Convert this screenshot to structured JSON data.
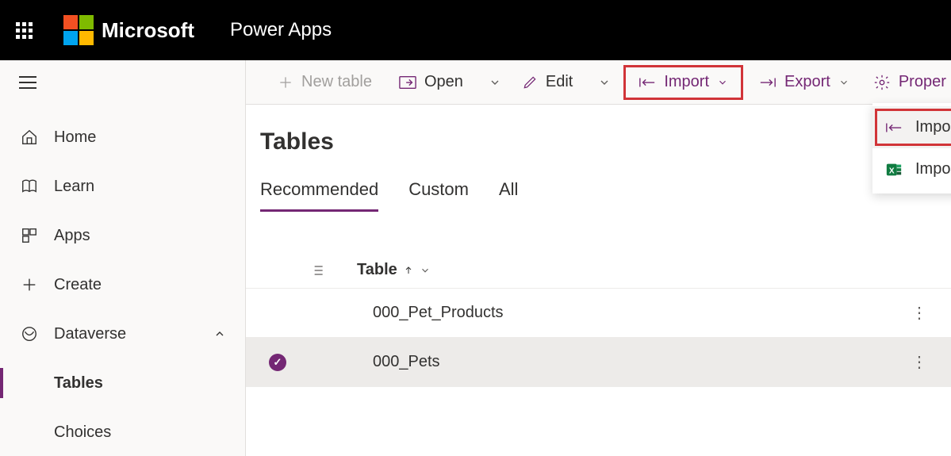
{
  "header": {
    "company": "Microsoft",
    "app": "Power Apps"
  },
  "sidebar": {
    "items": [
      {
        "key": "home",
        "label": "Home"
      },
      {
        "key": "learn",
        "label": "Learn"
      },
      {
        "key": "apps",
        "label": "Apps"
      },
      {
        "key": "create",
        "label": "Create"
      },
      {
        "key": "dataverse",
        "label": "Dataverse",
        "expanded": true,
        "children": [
          {
            "key": "tables",
            "label": "Tables",
            "selected": true
          },
          {
            "key": "choices",
            "label": "Choices"
          }
        ]
      }
    ]
  },
  "toolbar": {
    "new_table": "New table",
    "open": "Open",
    "edit": "Edit",
    "import": "Import",
    "export": "Export",
    "properties": "Proper"
  },
  "import_menu": {
    "items": [
      {
        "key": "import_data",
        "label": "Import data",
        "highlighted": true
      },
      {
        "key": "import_excel",
        "label": "Import data from Excel"
      }
    ]
  },
  "page": {
    "title": "Tables",
    "tabs": [
      {
        "key": "recommended",
        "label": "Recommended",
        "active": true
      },
      {
        "key": "custom",
        "label": "Custom"
      },
      {
        "key": "all",
        "label": "All"
      }
    ],
    "column_header": "Table",
    "rows": [
      {
        "name": "000_Pet_Products",
        "selected": false
      },
      {
        "name": "000_Pets",
        "selected": true
      }
    ]
  }
}
